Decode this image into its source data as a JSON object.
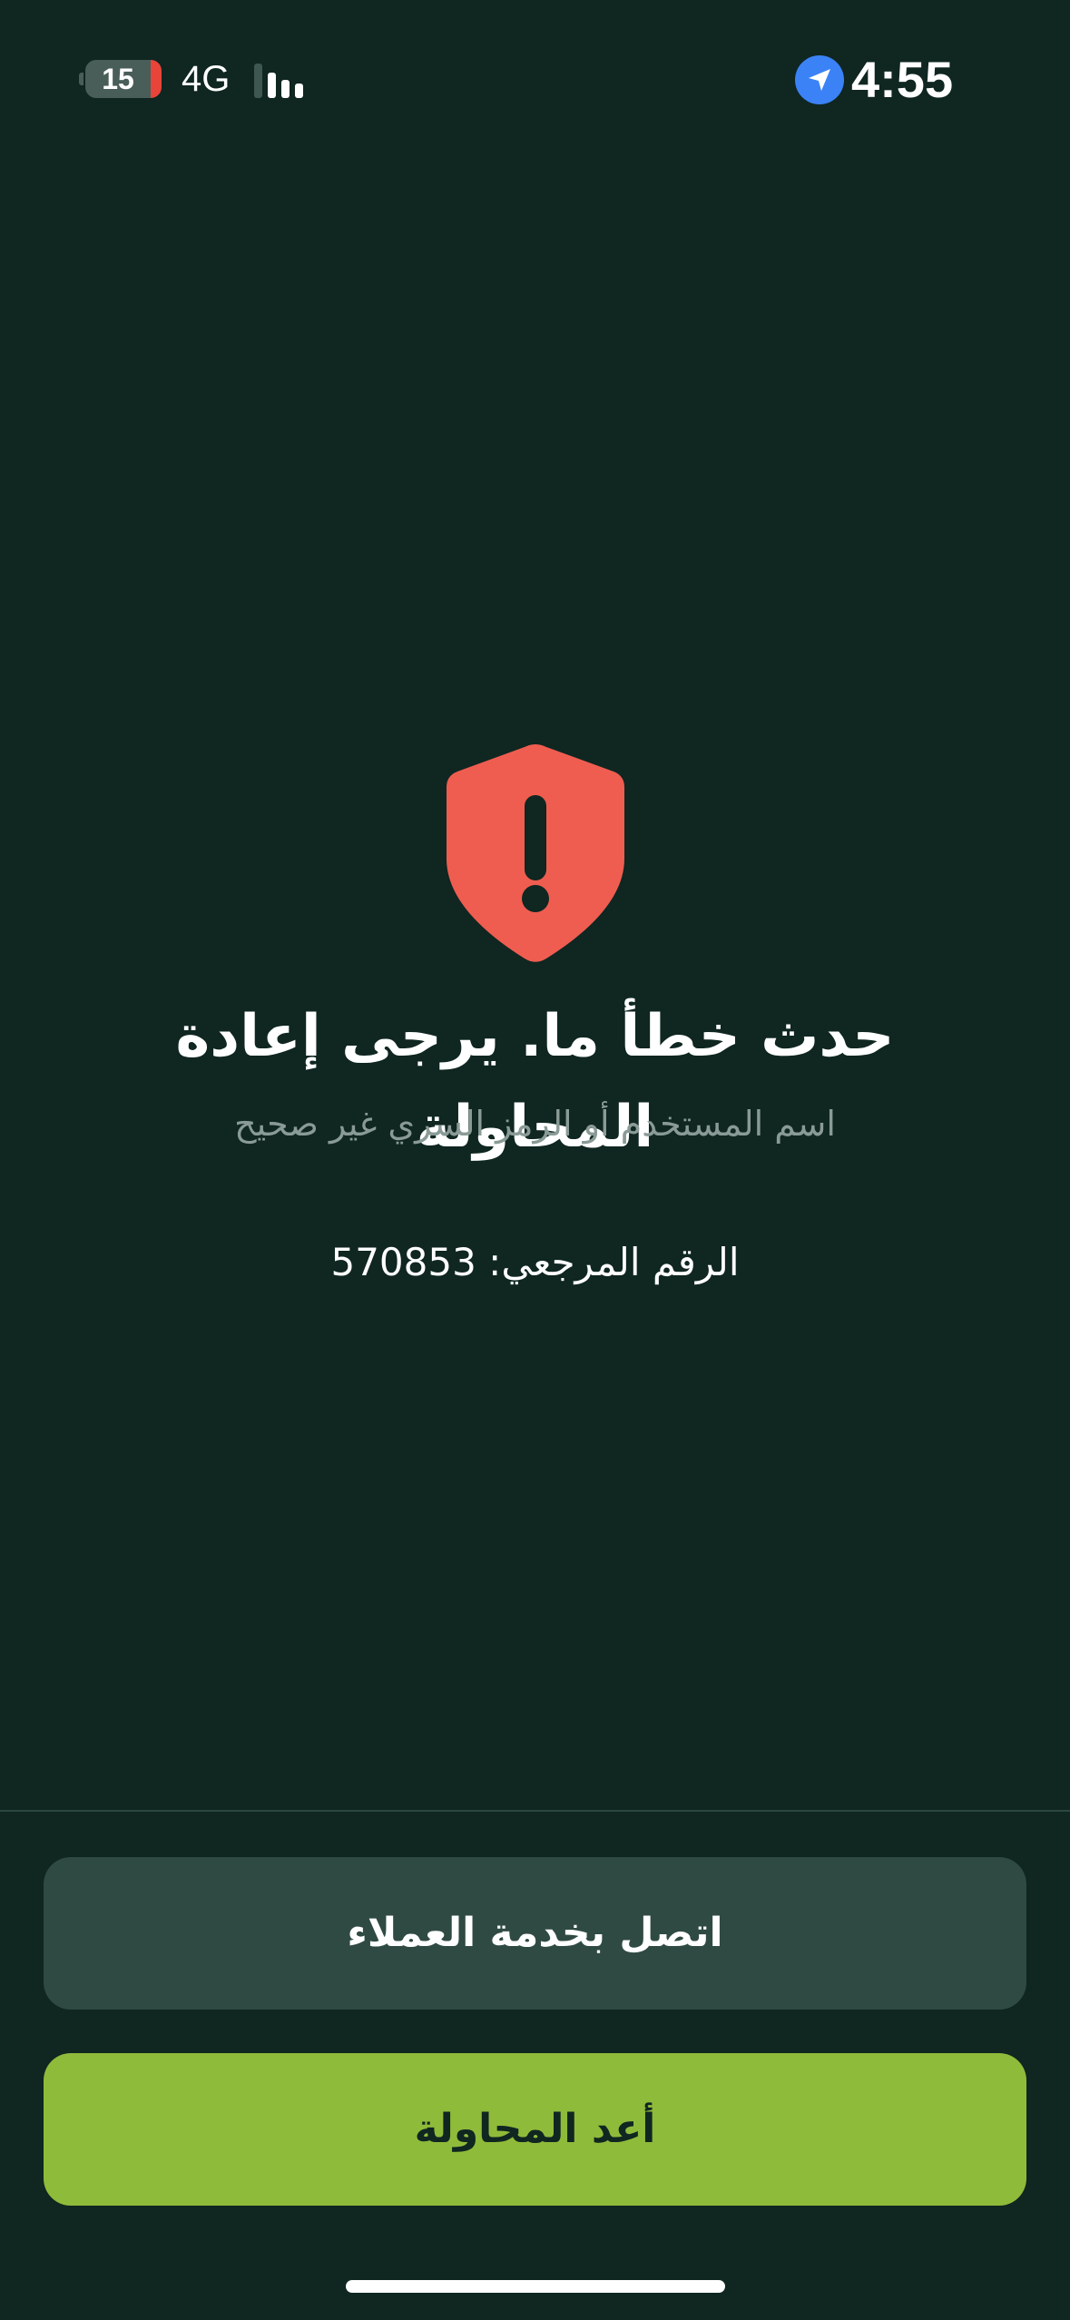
{
  "status_bar": {
    "battery_level": "15",
    "network": "4G",
    "time": "4:55",
    "icons": {
      "location": "location-arrow-icon",
      "signal": "signal-bars-icon",
      "battery": "battery-icon"
    }
  },
  "error": {
    "icon": "shield-exclamation-icon",
    "title": "حدث خطأ ما. يرجى إعادة المحاولة",
    "subtitle": "اسم المستخدم أو الرمز السري غير صحيح",
    "reference": "الرقم المرجعي: 570853"
  },
  "actions": {
    "contact_support_label": "اتصل بخدمة العملاء",
    "retry_label": "أعد المحاولة"
  },
  "colors": {
    "background": "#0f2621",
    "danger": "#ef5d50",
    "accent": "#8fbb3a",
    "secondary_button": "#2f4a43",
    "muted_text": "#8a9b96"
  }
}
